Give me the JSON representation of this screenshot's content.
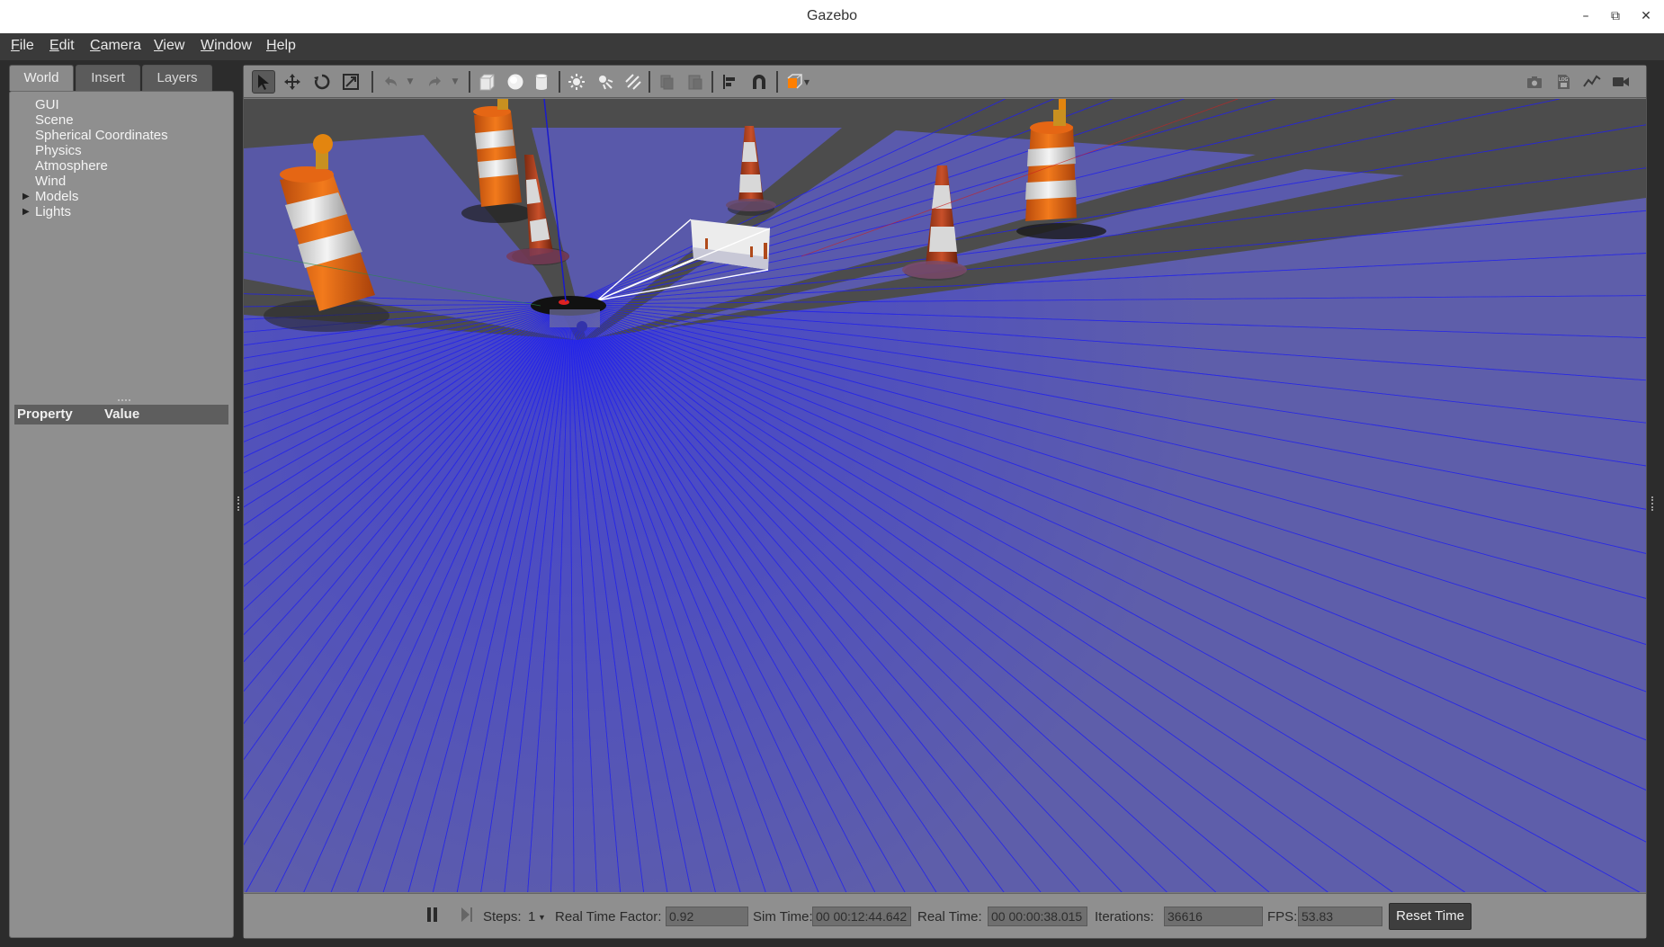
{
  "window": {
    "title": "Gazebo"
  },
  "menu": {
    "items": [
      {
        "mnemonic": "F",
        "rest": "ile"
      },
      {
        "mnemonic": "E",
        "rest": "dit"
      },
      {
        "mnemonic": "C",
        "rest": "amera"
      },
      {
        "mnemonic": "V",
        "rest": "iew"
      },
      {
        "mnemonic": "W",
        "rest": "indow"
      },
      {
        "mnemonic": "H",
        "rest": "elp"
      }
    ]
  },
  "left_panel": {
    "tabs": [
      "World",
      "Insert",
      "Layers"
    ],
    "active_tab": "World",
    "tree": [
      "GUI",
      "Scene",
      "Spherical Coordinates",
      "Physics",
      "Atmosphere",
      "Wind",
      "Models",
      "Lights"
    ],
    "property_header": {
      "property": "Property",
      "value": "Value"
    }
  },
  "toolbar": {
    "icons": [
      "select-arrow-icon",
      "translate-icon",
      "rotate-icon",
      "scale-icon",
      "undo-icon",
      "redo-icon",
      "box-icon",
      "sphere-icon",
      "cylinder-icon",
      "point-light-icon",
      "spot-light-icon",
      "directional-light-icon",
      "copy-icon",
      "paste-icon",
      "align-icon",
      "snap-magnet-icon",
      "view-angle-icon",
      "screenshot-icon",
      "log-icon",
      "plot-icon",
      "video-record-icon"
    ]
  },
  "bottom_bar": {
    "steps_label": "Steps:",
    "steps_value": "1",
    "rtf_label": "Real Time Factor:",
    "rtf_value": "0.92",
    "sim_time_label": "Sim Time:",
    "sim_time_value": "00 00:12:44.642",
    "real_time_label": "Real Time:",
    "real_time_value": "00 00:00:38.015",
    "iterations_label": "Iterations:",
    "iterations_value": "36616",
    "fps_label": "FPS:",
    "fps_value": "53.83",
    "reset_label": "Reset Time"
  },
  "colors": {
    "laser_blue": "#2a2aff",
    "laser_fill": "#5a5ab0",
    "barrel_orange": "#e8620f",
    "ground": "#4a4a4a"
  }
}
